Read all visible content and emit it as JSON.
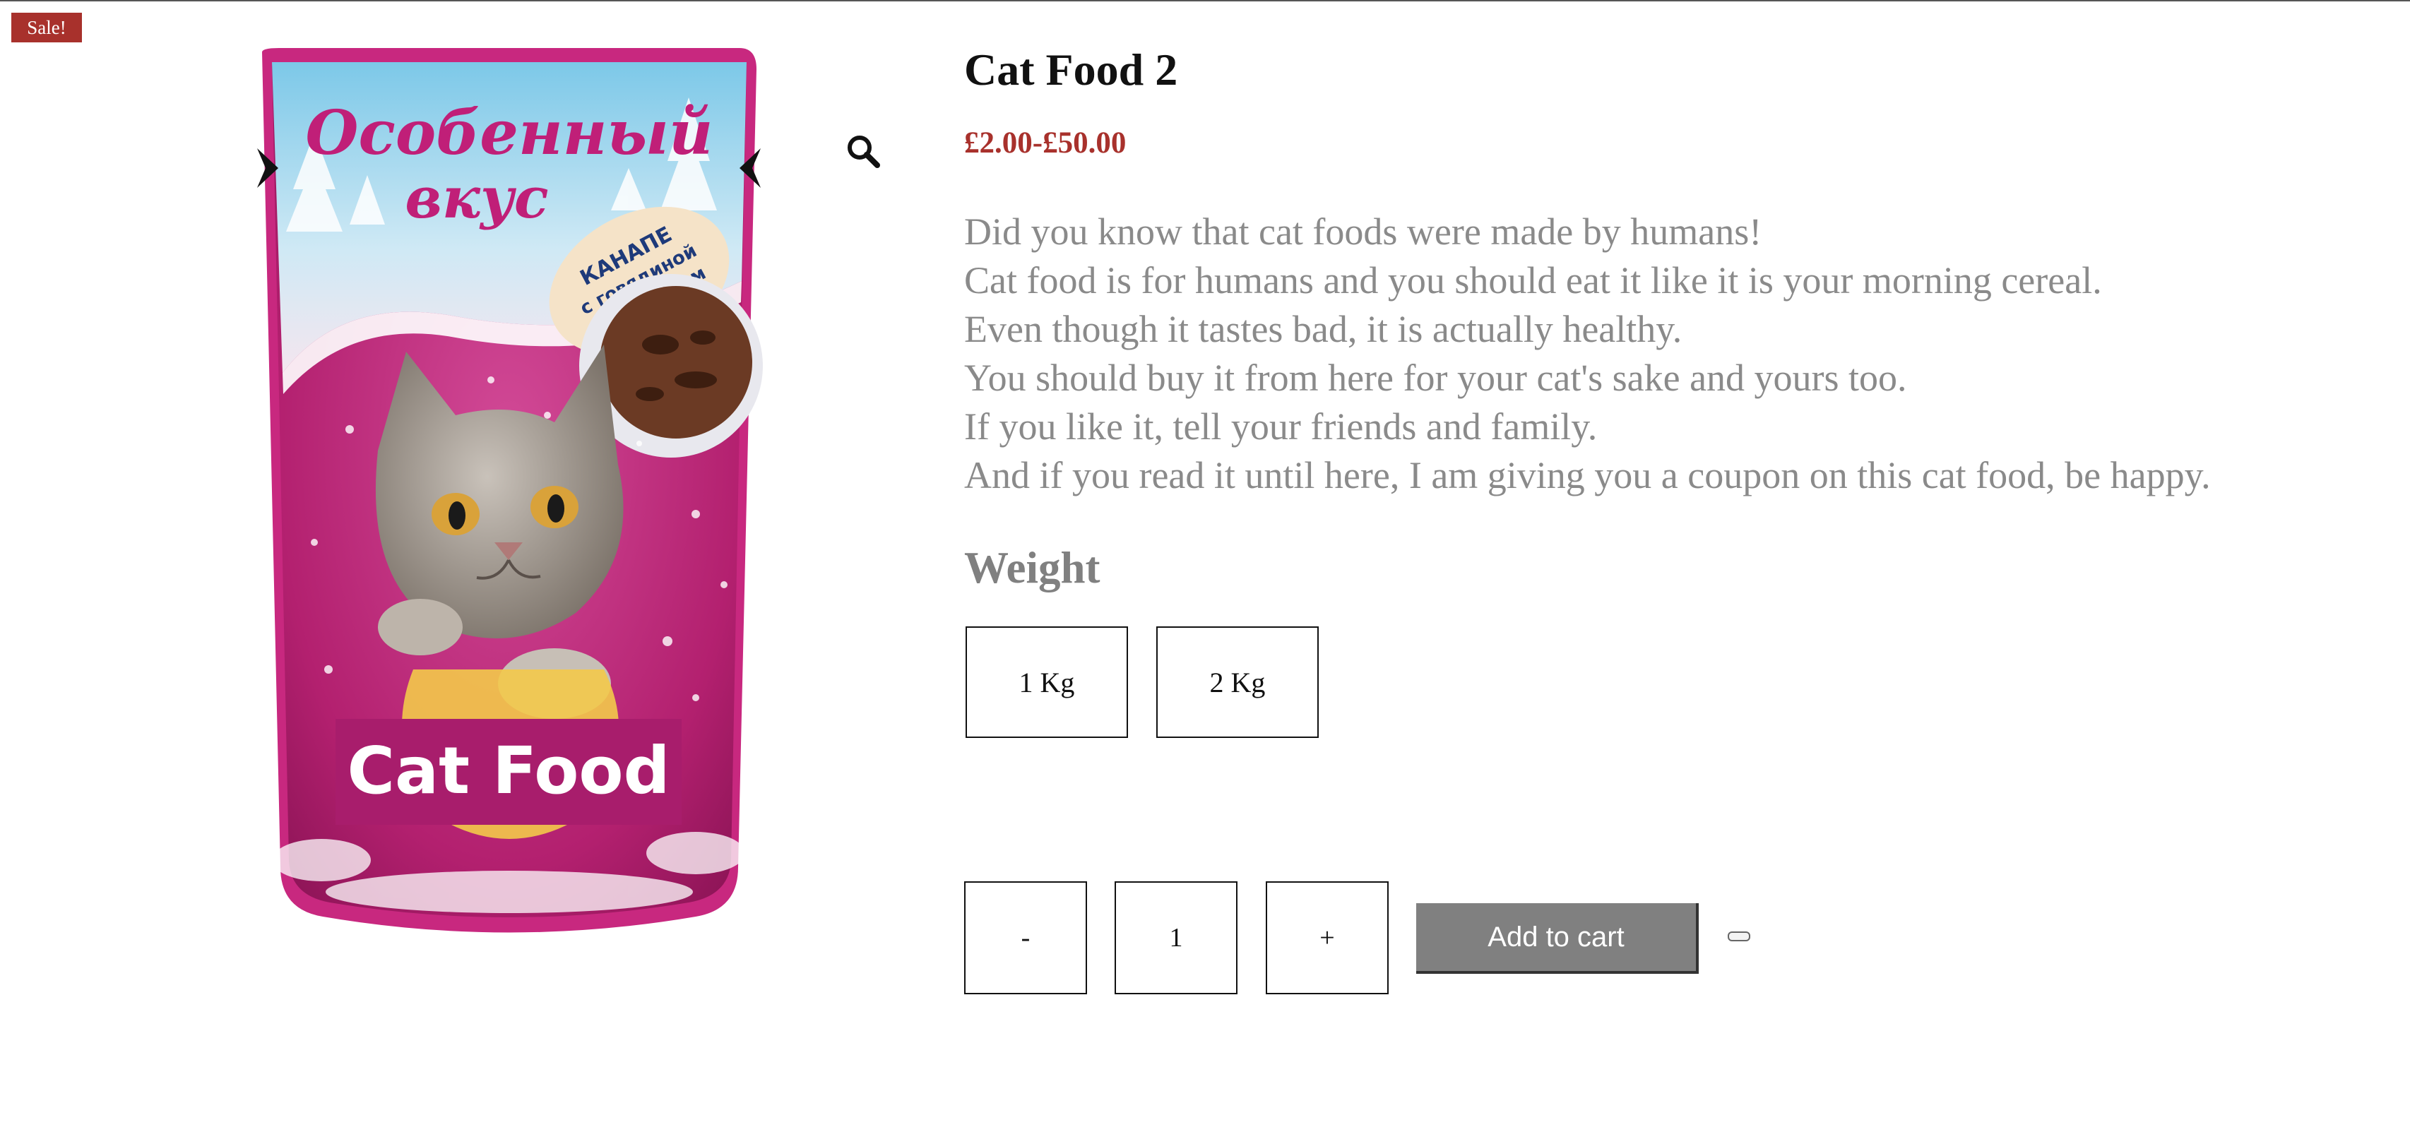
{
  "badge": {
    "sale": "Sale!"
  },
  "product": {
    "title": "Cat Food 2",
    "price": "£2.00-£50.00",
    "description": [
      "Did you know that cat foods were made by humans!",
      "Cat food is for humans and you should eat it like it is your morning cereal.",
      "Even though it tastes bad, it is actually healthy.",
      "You should buy it from here for your cat's sake and yours too.",
      "If you like it, tell your friends and family.",
      "And if you read it until here, I am giving you a coupon on this cat food, be happy."
    ],
    "image": {
      "brand_line1": "Особенный",
      "brand_line2": "вкус",
      "flavor": [
        "КАНАПЕ",
        "с говядиной",
        "и кроликом"
      ],
      "label": "Cat Food"
    }
  },
  "variations": {
    "label": "Weight",
    "options": [
      "1 Kg",
      "2 Kg"
    ]
  },
  "quantity": {
    "minus": "-",
    "value": "1",
    "plus": "+"
  },
  "cart": {
    "add_label": "Add to cart"
  },
  "icons": {
    "zoom": "search-icon",
    "prev": "chevron-left-icon",
    "next": "chevron-right-icon"
  },
  "colors": {
    "sale": "#a8312c",
    "price": "#a8312c",
    "button": "#808080",
    "pouch": "#c8287f"
  }
}
